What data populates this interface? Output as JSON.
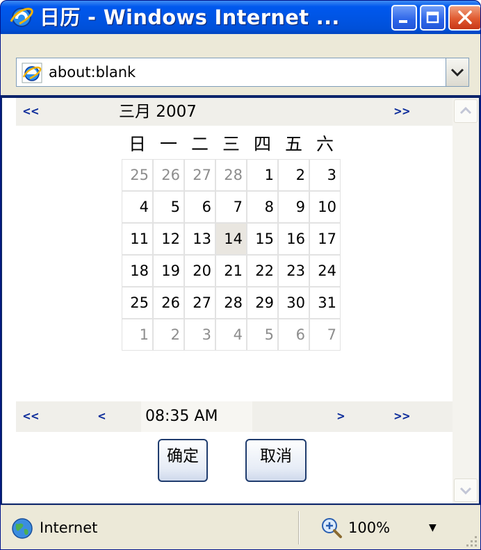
{
  "window": {
    "title": "日历 - Windows Internet ...",
    "icon": "ie-icon"
  },
  "address": {
    "url": "about:blank"
  },
  "calendar": {
    "prev_year": "<<",
    "next_year": ">>",
    "month_year": "三月  2007",
    "weekdays": [
      "日",
      "一",
      "二",
      "三",
      "四",
      "五",
      "六"
    ],
    "weeks": [
      [
        "25",
        "26",
        "27",
        "28",
        "1",
        "2",
        "3"
      ],
      [
        "4",
        "5",
        "6",
        "7",
        "8",
        "9",
        "10"
      ],
      [
        "11",
        "12",
        "13",
        "14",
        "15",
        "16",
        "17"
      ],
      [
        "18",
        "19",
        "20",
        "21",
        "22",
        "23",
        "24"
      ],
      [
        "25",
        "26",
        "27",
        "28",
        "29",
        "30",
        "31"
      ],
      [
        "1",
        "2",
        "3",
        "4",
        "5",
        "6",
        "7"
      ]
    ],
    "selected_day": "14",
    "time_nav": {
      "prev_hour": "<<",
      "prev_min": "<",
      "time": "08:35 AM",
      "next_min": ">",
      "next_hour": ">>"
    },
    "ok_label": "确定",
    "cancel_label": "取消"
  },
  "status": {
    "zone": "Internet",
    "zoom": "100%"
  },
  "colors": {
    "titlebar": "#0054e3",
    "nav_link": "#0e2e9b",
    "today_bg": "#e9e6e0",
    "muted_day": "#8d8d8d"
  }
}
